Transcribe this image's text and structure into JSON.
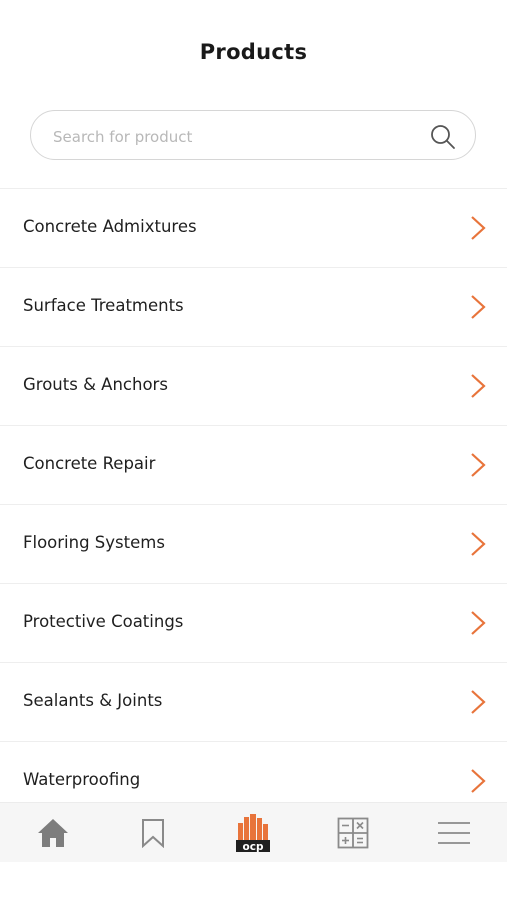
{
  "header": {
    "title": "Products"
  },
  "search": {
    "placeholder": "Search for product",
    "value": ""
  },
  "categories": [
    {
      "label": "Concrete Admixtures"
    },
    {
      "label": "Surface Treatments"
    },
    {
      "label": "Grouts & Anchors"
    },
    {
      "label": "Concrete Repair"
    },
    {
      "label": "Flooring Systems"
    },
    {
      "label": "Protective Coatings"
    },
    {
      "label": "Sealants & Joints"
    },
    {
      "label": "Waterproofing"
    }
  ],
  "tabbar": {
    "tabs": [
      {
        "icon": "home-icon"
      },
      {
        "icon": "bookmark-icon"
      },
      {
        "icon": "ocp-logo-icon",
        "logo_text": "ocp"
      },
      {
        "icon": "calculator-icon"
      },
      {
        "icon": "menu-icon"
      }
    ]
  },
  "colors": {
    "accent": "#e8743b",
    "text": "#1f1f1f",
    "icon_gray": "#8a8a8a",
    "divider": "#eeeeee"
  }
}
